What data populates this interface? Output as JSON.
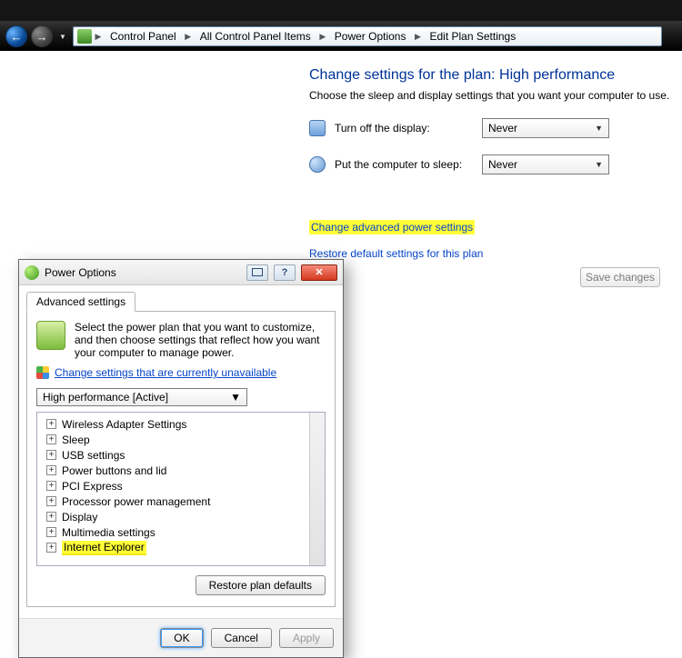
{
  "breadcrumbs": {
    "root": "Control Panel",
    "b1": "All Control Panel Items",
    "b2": "Power Options",
    "b3": "Edit Plan Settings"
  },
  "main": {
    "heading": "Change settings for the plan: High performance",
    "sub": "Choose the sleep and display settings that you want your computer to use.",
    "row_display_label": "Turn off the display:",
    "row_display_value": "Never",
    "row_sleep_label": "Put the computer to sleep:",
    "row_sleep_value": "Never",
    "link_advanced": "Change advanced power settings",
    "link_restore": "Restore default settings for this plan",
    "save_button": "Save changes"
  },
  "dialog": {
    "title": "Power Options",
    "tab": "Advanced settings",
    "desc": "Select the power plan that you want to customize, and then choose settings that reflect how you want your computer to manage power.",
    "shield_link": "Change settings that are currently unavailable",
    "plan_select": "High performance [Active]",
    "tree": [
      "Wireless Adapter Settings",
      "Sleep",
      "USB settings",
      "Power buttons and lid",
      "PCI Express",
      "Processor power management",
      "Display",
      "Multimedia settings",
      "Internet Explorer"
    ],
    "restore_btn": "Restore plan defaults",
    "ok": "OK",
    "cancel": "Cancel",
    "apply": "Apply"
  }
}
